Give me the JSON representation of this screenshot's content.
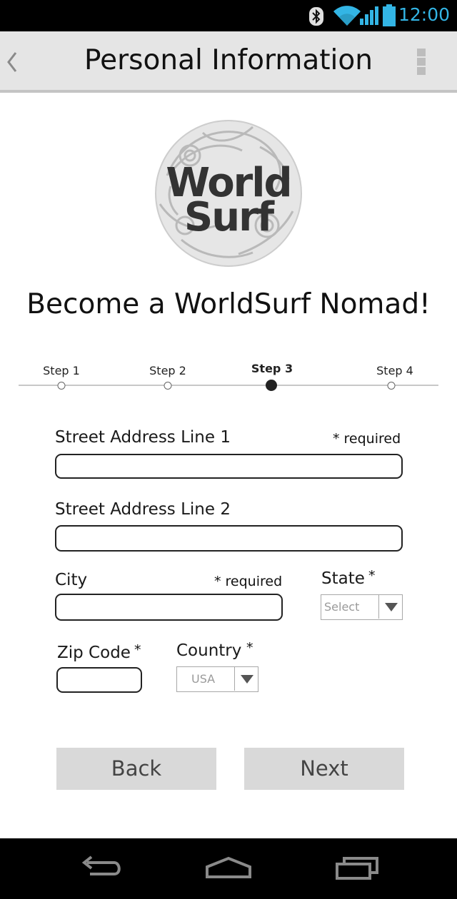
{
  "status_bar": {
    "time": "12:00",
    "icons": [
      "bluetooth-icon",
      "wifi-icon",
      "signal-icon",
      "battery-icon"
    ],
    "accent_color": "#33b5e5"
  },
  "action_bar": {
    "title": "Personal Information",
    "back_icon": "chevron-left-icon",
    "menu_icon": "overflow-menu-icon"
  },
  "logo": {
    "line1": "World",
    "line2": "Surf"
  },
  "headline": "Become a WorldSurf Nomad!",
  "stepper": {
    "steps": [
      {
        "label": "Step 1"
      },
      {
        "label": "Step 2"
      },
      {
        "label": "Step 3"
      },
      {
        "label": "Step 4"
      }
    ],
    "current_step": 3
  },
  "form": {
    "street1": {
      "label": "Street Address Line 1",
      "required_note": "* required",
      "value": ""
    },
    "street2": {
      "label": "Street Address Line 2",
      "value": ""
    },
    "city": {
      "label": "City",
      "required_note": "* required",
      "value": ""
    },
    "state": {
      "label": "State",
      "asterisk": "*",
      "selected": "Select"
    },
    "zip": {
      "label": "Zip Code",
      "asterisk": "*",
      "value": ""
    },
    "country": {
      "label": "Country",
      "asterisk": "*",
      "selected": "USA"
    }
  },
  "buttons": {
    "back": "Back",
    "next": "Next"
  },
  "nav_bar": {
    "icons": [
      "nav-back-icon",
      "nav-home-icon",
      "nav-recents-icon"
    ]
  }
}
